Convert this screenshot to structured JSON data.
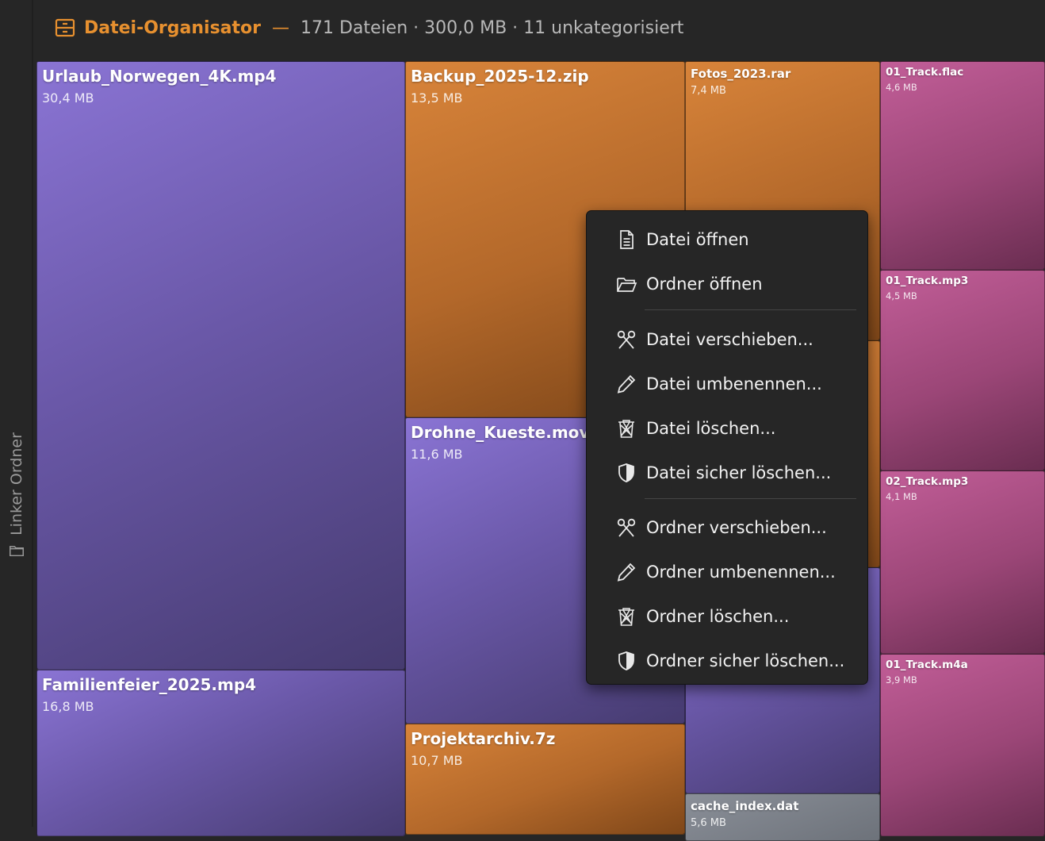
{
  "sidebar": {
    "label": "Linker Ordner",
    "icon": "folder-icon"
  },
  "header": {
    "icon": "organizer-icon",
    "title": "Datei-Organisator",
    "separator": "—",
    "stats": "171 Dateien · 300,0 MB · 11 unkategorisiert"
  },
  "colors": {
    "video": "#7a66c0",
    "archive": "#c87832",
    "audio": "#b05288",
    "other": "#7c8189",
    "accent": "#e7902f"
  },
  "tiles": [
    {
      "name": "Urlaub_Norwegen_4K.mp4",
      "size": "30,4 MB",
      "type": "video"
    },
    {
      "name": "Familienfeier_2025.mp4",
      "size": "16,8 MB",
      "type": "video"
    },
    {
      "name": "Backup_2025-12.zip",
      "size": "13,5 MB",
      "type": "archive"
    },
    {
      "name": "Drohne_Kueste.mov",
      "size": "11,6 MB",
      "type": "video"
    },
    {
      "name": "Projektarchiv.7z",
      "size": "10,7 MB",
      "type": "archive"
    },
    {
      "name": "Fotos_2023.rar",
      "size": "7,4 MB",
      "type": "archive"
    },
    {
      "name": "cache_index.dat",
      "size": "5,6 MB",
      "type": "other"
    },
    {
      "name": "01_Track.flac",
      "size": "4,6 MB",
      "type": "audio"
    },
    {
      "name": "01_Track.mp3",
      "size": "4,5 MB",
      "type": "audio"
    },
    {
      "name": "02_Track.mp3",
      "size": "4,1 MB",
      "type": "audio"
    },
    {
      "name": "01_Track.m4a",
      "size": "3,9 MB",
      "type": "audio"
    }
  ],
  "context_menu": {
    "items": [
      {
        "label": "Datei öffnen",
        "icon": "file-icon"
      },
      {
        "label": "Ordner öffnen",
        "icon": "folder-open-icon"
      },
      {
        "label": "Datei verschieben...",
        "icon": "scissors-icon"
      },
      {
        "label": "Datei umbenennen...",
        "icon": "pencil-icon"
      },
      {
        "label": "Datei löschen...",
        "icon": "trash-icon"
      },
      {
        "label": "Datei sicher löschen...",
        "icon": "shield-icon"
      },
      {
        "label": "Ordner verschieben...",
        "icon": "scissors-icon"
      },
      {
        "label": "Ordner umbenennen...",
        "icon": "pencil-icon"
      },
      {
        "label": "Ordner löschen...",
        "icon": "trash-icon"
      },
      {
        "label": "Ordner sicher löschen...",
        "icon": "shield-icon"
      }
    ]
  }
}
